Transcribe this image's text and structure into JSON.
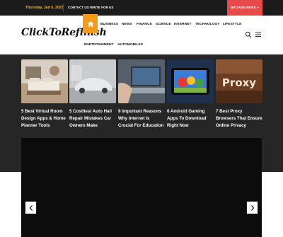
{
  "topbar": {
    "date": "Thursday, Jan 5, 2023",
    "links": [
      "CONTACT US",
      "WRITE FOR US"
    ],
    "browse": "BROWSE MORE +"
  },
  "logo": "ClickToRefinish",
  "nav": {
    "items": [
      "BUSINESS",
      "NEWS",
      "FINANCE",
      "SCIENCE",
      "INTERNET",
      "TECHNOLOGY",
      "LIFESTYLE",
      "ENETRTAINMENT",
      "AUTOMOBILES"
    ]
  },
  "cards": [
    {
      "title": "5 Best Virtual Room Design Apps & Home Planner Tools"
    },
    {
      "title": "5 Costliest Auto Hail Repair Mistakes Car Owners Make"
    },
    {
      "title": "9 Important Reasons Why Internet Is Crucial For Education"
    },
    {
      "title": "6 Android Gaming Apps To Download Right Now"
    },
    {
      "title": "7 Best Proxy Browsers That Ensure Online Privacy",
      "image_text": "Proxy"
    }
  ],
  "colors": {
    "accent_orange": "#f59a19",
    "browse_red": "#e8494a",
    "date_yellow": "#f5b51f",
    "hero_bg": "#262626"
  },
  "icons": [
    "home-icon",
    "search-icon",
    "menu-icon",
    "chevron-left-icon",
    "chevron-right-icon"
  ]
}
